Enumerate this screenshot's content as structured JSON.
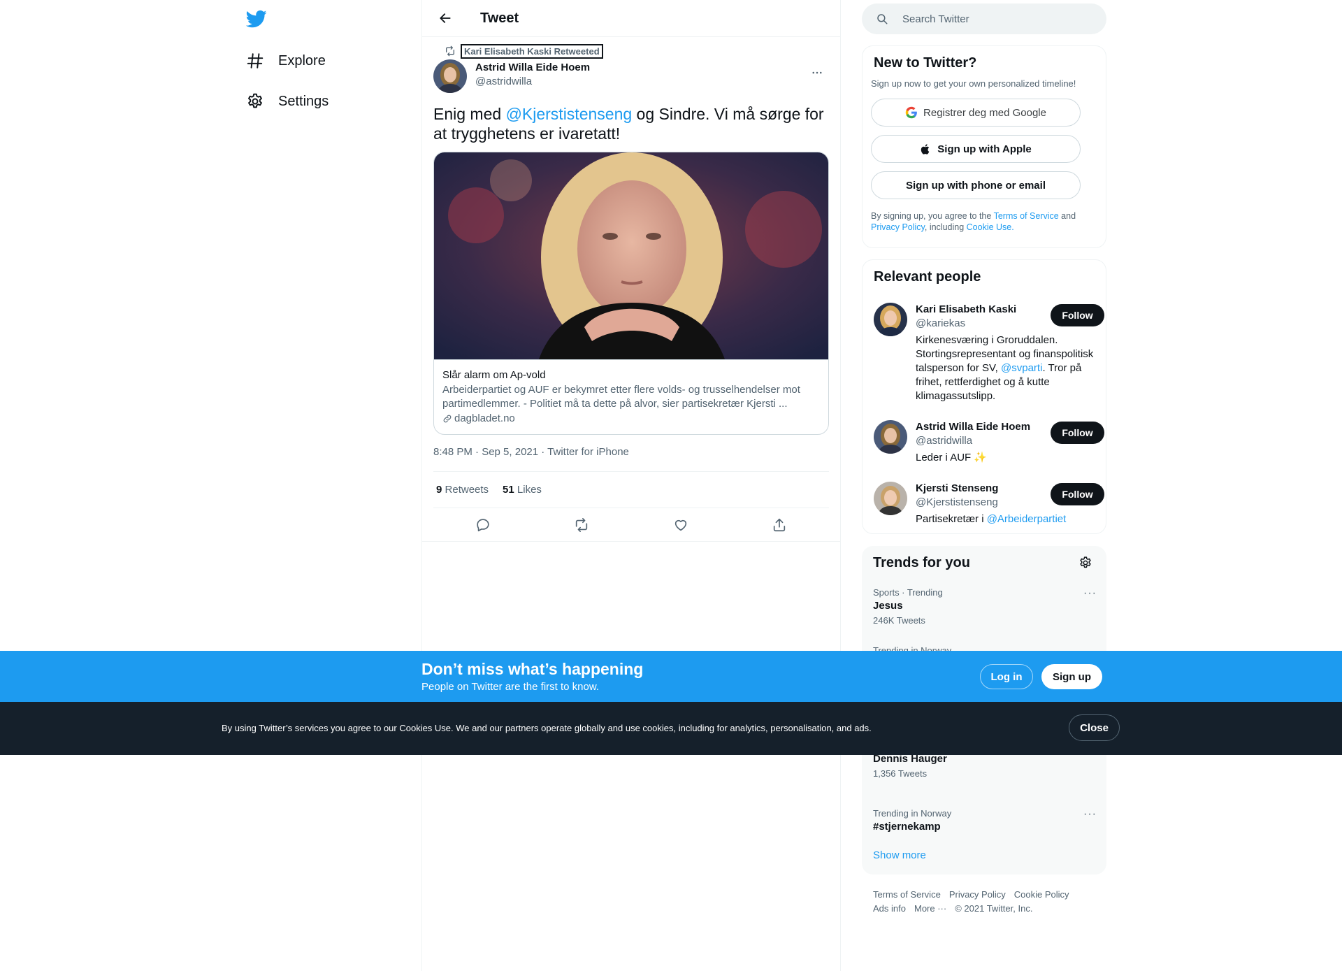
{
  "nav": {
    "items": [
      {
        "label": "Explore",
        "icon": "hashtag-icon"
      },
      {
        "label": "Settings",
        "icon": "gear-icon"
      }
    ]
  },
  "header": {
    "title": "Tweet"
  },
  "tweet": {
    "retweeted_by": "Kari Elisabeth Kaski Retweeted",
    "author_name": "Astrid Willa Eide Hoem",
    "author_handle": "@astridwilla",
    "text_pre": "Enig med ",
    "text_mention": "@Kjerstistenseng",
    "text_post": " og Sindre. Vi må sørge for at trygghetens er ivaretatt!",
    "card": {
      "title": "Slår alarm om Ap-vold",
      "description": "Arbeiderpartiet og AUF er bekymret etter flere volds- og trusselhendelser mot partimedlemmer. - Politiet må ta dette på alvor, sier partisekretær Kjersti ...",
      "domain": "dagbladet.no"
    },
    "timestamp": "8:48 PM · Sep 5, 2021 · Twitter for iPhone",
    "retweets_count": "9",
    "retweets_label": "Retweets",
    "likes_count": "51",
    "likes_label": "Likes"
  },
  "search": {
    "placeholder": "Search Twitter"
  },
  "signup_panel": {
    "title": "New to Twitter?",
    "subtitle": "Sign up now to get your own personalized timeline!",
    "google_label": "Registrer deg med Google",
    "apple_label": "Sign up with Apple",
    "phone_label": "Sign up with phone or email",
    "legal_1": "By signing up, you agree to the ",
    "legal_tos": "Terms of Service",
    "legal_2": " and ",
    "legal_privacy": "Privacy Policy",
    "legal_3": ", including ",
    "legal_cookie": "Cookie Use."
  },
  "people_panel": {
    "title": "Relevant people",
    "follow_label": "Follow",
    "people": [
      {
        "name": "Kari Elisabeth Kaski",
        "handle": "@kariekas",
        "bio_pre": "Kirkenesværing i Groruddalen. Stortingsrepresentant og finanspolitisk talsperson for SV, ",
        "bio_link": "@svparti",
        "bio_post": ". Tror på frihet, rettferdighet og å kutte klimagassutslipp."
      },
      {
        "name": "Astrid Willa Eide Hoem",
        "handle": "@astridwilla",
        "bio_pre": "Leder i AUF ",
        "bio_link": "",
        "bio_post": "✨"
      },
      {
        "name": "Kjersti Stenseng",
        "handle": "@Kjerstistenseng",
        "bio_pre": "Partisekretær i ",
        "bio_link": "@Arbeiderpartiet",
        "bio_post": ""
      }
    ]
  },
  "trends_panel": {
    "title": "Trends for you",
    "trends": [
      {
        "meta": "Sports · Trending",
        "name": "Jesus",
        "count": "246K Tweets"
      },
      {
        "meta": "Trending in Norway",
        "name": "",
        "count": ""
      },
      {
        "meta": "",
        "name": "Dennis Hauger",
        "count": "1,356 Tweets"
      },
      {
        "meta": "Trending in Norway",
        "name": "#stjernekamp",
        "count": ""
      }
    ],
    "show_more": "Show more"
  },
  "footer": {
    "links_row1": [
      "Terms of Service",
      "Privacy Policy",
      "Cookie Policy"
    ],
    "links_row2": [
      "Ads info",
      "More ···",
      "© 2021 Twitter, Inc."
    ]
  },
  "bottom_bar": {
    "title": "Don’t miss what’s happening",
    "subtitle": "People on Twitter are the first to know.",
    "login_label": "Log in",
    "signup_label": "Sign up"
  },
  "cookie_bar": {
    "text": "By using Twitter’s services you agree to our Cookies Use. We and our partners operate globally and use cookies, including for analytics, personalisation, and ads.",
    "close_label": "Close"
  },
  "colors": {
    "accent": "#1d9bf0",
    "dark": "#0f1419",
    "muted": "#536471",
    "cookie_bg": "#15202b"
  }
}
